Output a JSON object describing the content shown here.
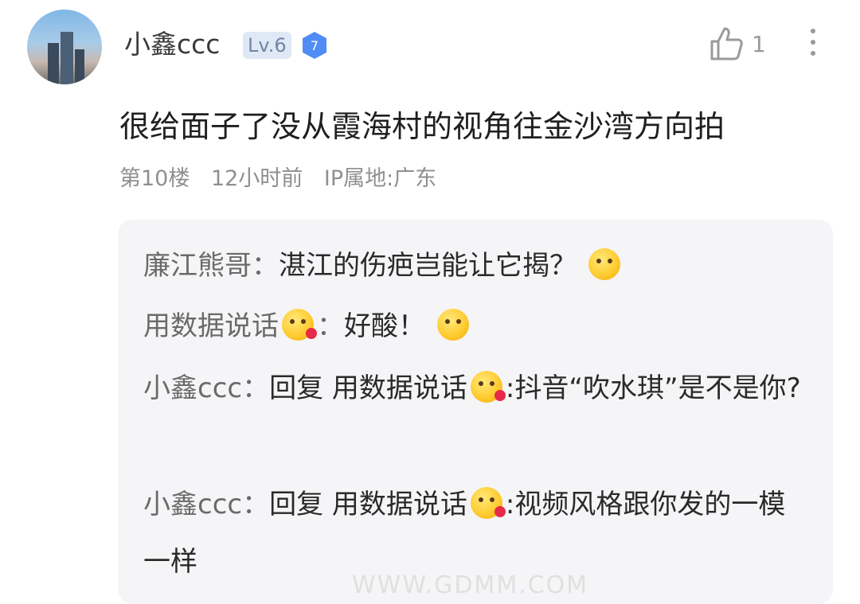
{
  "comment": {
    "username": "小鑫ccc",
    "level": "Lv.6",
    "badge_number": "7",
    "like_count": "1",
    "text": "很给面子了没从霞海村的视角往金沙湾方向拍",
    "floor": "第10楼",
    "time": "12小时前",
    "ip": "IP属地:广东"
  },
  "replies": [
    {
      "name": "廉江熊哥",
      "separator": "：",
      "text": "湛江的伤疤岂能让它揭？",
      "emoji": "grinning-face"
    },
    {
      "name": "用数据说话",
      "separator": "：",
      "text": "好酸！",
      "emoji": "face-with-hand-over-mouth"
    },
    {
      "name": "小鑫ccc",
      "separator": "：",
      "prefix": "回复 ",
      "mention": "用数据说话",
      "text": ":抖音“吹水琪”是不是你?"
    },
    {
      "name": "小鑫ccc",
      "separator": "：",
      "prefix": "回复 ",
      "mention": "用数据说话",
      "text": ":视频风格跟你发的一模一样"
    }
  ],
  "watermark": "WWW.GDMM.COM"
}
